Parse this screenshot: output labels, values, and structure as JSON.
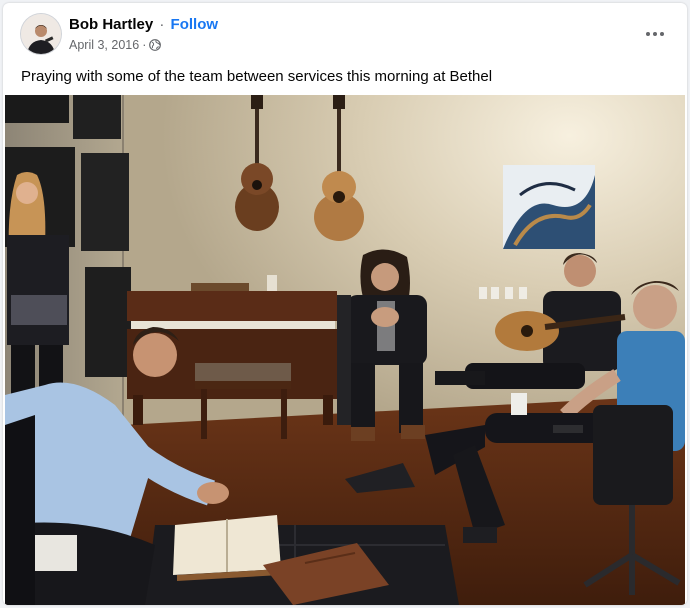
{
  "post": {
    "author": "Bob Hartley",
    "separator": "·",
    "follow_label": "Follow",
    "date": "April 3, 2016",
    "meta_separator": "·",
    "privacy_icon": "globe-icon",
    "more_icon": "more-options-icon",
    "caption": "Praying with some of the team between services this morning at Bethel"
  },
  "colors": {
    "link": "#1877f2",
    "secondary_text": "#65676b",
    "primary_text": "#050505"
  }
}
